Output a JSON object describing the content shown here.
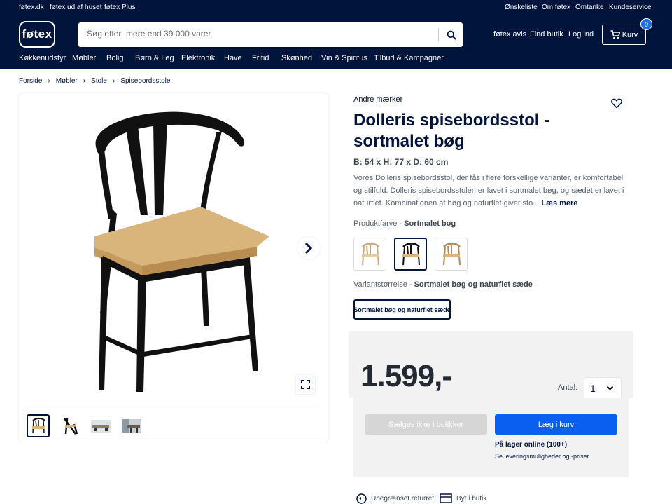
{
  "topbar": {
    "links": [
      "føtex.dk",
      "føtex ud af huset",
      "føtex Plus"
    ],
    "right_links": [
      "Ønskeliste",
      "Om føtex",
      "Omtanke",
      "Kundeservice"
    ]
  },
  "header": {
    "logo": "føtex",
    "search_placeholder": "Søg efter  mere end 39.000 varer",
    "links": [
      "føtex avis",
      "Find butik",
      "Log ind"
    ],
    "cart_label": "Kurv",
    "cart_count": "0"
  },
  "nav": {
    "items": [
      "Køkkenudstyr",
      "Møbler",
      "Bolig",
      "Børn & Leg",
      "Elektronik",
      "Have",
      "Fritid",
      "Skønhed",
      "Vin & Spiritus",
      "Tilbud & Kampagner"
    ]
  },
  "breadcrumb": [
    "Forside",
    "Møbler",
    "Stole",
    "Spisebordsstole"
  ],
  "product": {
    "brand": "Andre mærker",
    "title": "Dolleris spisebordsstol - sortmalet bøg",
    "dimensions": "B: 54 x H: 77 x D: 60 cm",
    "description": "Vores Dolleris spisebordsstol, der fås i flere forskellige varianter, er komfortabel og stilfuld. Dolleris spisebordsstolen er lavet i sortmalet bøg, og sædet er lavet i naturflet. Kombinationen af bøg og naturflet giver sto...",
    "read_more": "Læs mere",
    "color_label": "Produktfarve - ",
    "color_value": "Sortmalet bøg",
    "size_label": "Variantstørrelse - ",
    "size_value": "Sortmalet bøg og naturflet sæde",
    "size_option": "Sortmalet bøg og naturflet sæde",
    "price": "1.599,-",
    "qty_label": "Antal:",
    "qty_value": "1",
    "store_button": "Sælges ikke i butikker",
    "cart_button": "Læg i kurv",
    "stock": "På lager online (100+)",
    "delivery_link": "Se leveringsmuligheder og -priser"
  },
  "usps": [
    "Ubegrænset returret",
    "Byt i butik"
  ],
  "colors": {
    "navy": "#00143c",
    "cart_blue": "#0a5ef0",
    "seat": "#d9b57c"
  }
}
